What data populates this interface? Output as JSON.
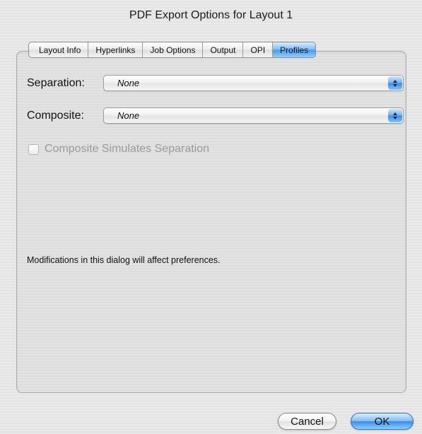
{
  "window": {
    "title": "PDF Export Options for Layout 1"
  },
  "tabs": [
    {
      "label": "Layout Info",
      "selected": false
    },
    {
      "label": "Hyperlinks",
      "selected": false
    },
    {
      "label": "Job Options",
      "selected": false
    },
    {
      "label": "Output",
      "selected": false
    },
    {
      "label": "OPI",
      "selected": false
    },
    {
      "label": "Profiles",
      "selected": true
    }
  ],
  "fields": {
    "separation": {
      "label": "Separation:",
      "value": "None"
    },
    "composite": {
      "label": "Composite:",
      "value": "None"
    }
  },
  "checkbox": {
    "label": "Composite Simulates Separation",
    "checked": false,
    "enabled": false
  },
  "note": "Modifications in this dialog will affect preferences.",
  "buttons": {
    "cancel": "Cancel",
    "ok": "OK"
  },
  "colors": {
    "accent": "#4a96e8",
    "disabled_text": "#9a9a9a"
  }
}
